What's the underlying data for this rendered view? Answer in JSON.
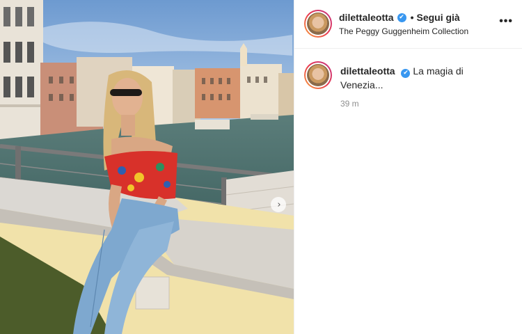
{
  "post": {
    "username": "dilettaleotta",
    "follow_label": "Segui già",
    "location": "The Peggy Guggenheim Collection",
    "more_label": "•••",
    "verified_icon": "✔",
    "next_icon": "›"
  },
  "caption": {
    "username": "dilettaleotta",
    "text": "La magia di Venezia...",
    "timestamp": "39 m"
  },
  "colors": {
    "verified": "#3897f0",
    "story_ring_start": "#f9a33c",
    "story_ring_end": "#c13584",
    "muted_text": "#8e8e8e"
  }
}
